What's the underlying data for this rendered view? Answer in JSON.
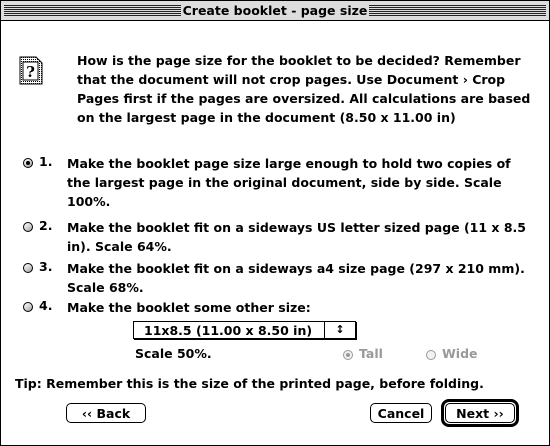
{
  "window": {
    "title": "Create booklet - page size"
  },
  "question": {
    "icon": "document-question-icon",
    "lines": [
      "How is the page size for the booklet to be decided? Remember",
      "that the document will not crop pages. Use Document › Crop",
      "Pages first if the pages are oversized. All calculations are based",
      "on the largest page in the document (8.50 x 11.00 in)"
    ]
  },
  "options": [
    {
      "number": "1.",
      "selected": true,
      "lines": [
        "Make the booklet page size large enough to hold two copies of",
        "the largest page in the original document, side by side. Scale",
        "100%."
      ]
    },
    {
      "number": "2.",
      "selected": false,
      "lines": [
        "Make the booklet fit on a sideways US letter sized page (11 x 8.5",
        "in). Scale 64%."
      ]
    },
    {
      "number": "3.",
      "selected": false,
      "lines": [
        "Make the booklet fit on a sideways a4 size page (297 x 210 mm).",
        "Scale 68%."
      ]
    },
    {
      "number": "4.",
      "selected": false,
      "lines": [
        "Make the booklet some other size:"
      ]
    }
  ],
  "other_size": {
    "selected_value": "11x8.5 (11.00 x 8.50 in)",
    "arrow_glyph": "↕",
    "scale": "Scale 50%.",
    "orientation": {
      "tall_label": "Tall",
      "wide_label": "Wide",
      "selected": "Tall"
    }
  },
  "tip": "Tip: Remember this is the size of the printed page, before folding.",
  "buttons": {
    "back": "‹‹ Back",
    "cancel": "Cancel",
    "next": "Next ››"
  }
}
